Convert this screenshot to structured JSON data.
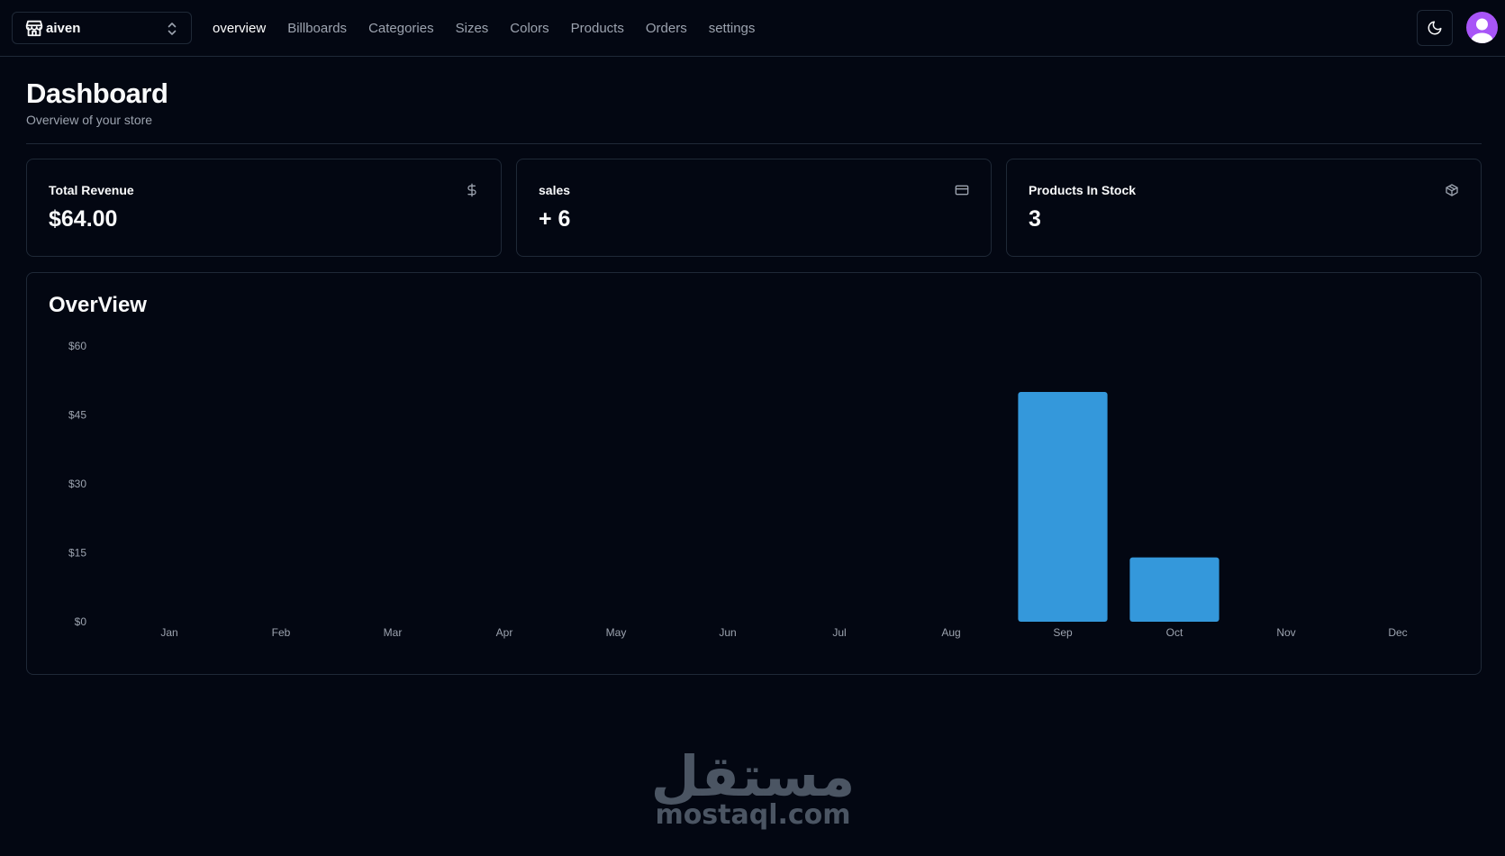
{
  "header": {
    "store_name": "aiven",
    "nav": [
      {
        "label": "overview",
        "active": true
      },
      {
        "label": "Billboards",
        "active": false
      },
      {
        "label": "Categories",
        "active": false
      },
      {
        "label": "Sizes",
        "active": false
      },
      {
        "label": "Colors",
        "active": false
      },
      {
        "label": "Products",
        "active": false
      },
      {
        "label": "Orders",
        "active": false
      },
      {
        "label": "settings",
        "active": false
      }
    ],
    "theme_icon": "moon-icon",
    "avatar_color": "#a855f7"
  },
  "page": {
    "title": "Dashboard",
    "subtitle": "Overview of your store"
  },
  "stats": [
    {
      "label": "Total Revenue",
      "value": "$64.00",
      "icon": "dollar-icon"
    },
    {
      "label": "sales",
      "value": "+ 6",
      "icon": "credit-card-icon"
    },
    {
      "label": "Products In Stock",
      "value": "3",
      "icon": "package-icon"
    }
  ],
  "overview": {
    "title": "OverView"
  },
  "chart_data": {
    "type": "bar",
    "categories": [
      "Jan",
      "Feb",
      "Mar",
      "Apr",
      "May",
      "Jun",
      "Jul",
      "Aug",
      "Sep",
      "Oct",
      "Nov",
      "Dec"
    ],
    "values": [
      0,
      0,
      0,
      0,
      0,
      0,
      0,
      0,
      50,
      14,
      0,
      0
    ],
    "ylim": [
      0,
      60
    ],
    "yticks": [
      "$0",
      "$15",
      "$30",
      "$45",
      "$60"
    ],
    "ytick_values": [
      0,
      15,
      30,
      45,
      60
    ],
    "bar_color": "#3498db",
    "grid": false,
    "title": "",
    "xlabel": "",
    "ylabel": ""
  },
  "watermark": {
    "arabic": "مستقل",
    "latin": "mostaql.com"
  }
}
